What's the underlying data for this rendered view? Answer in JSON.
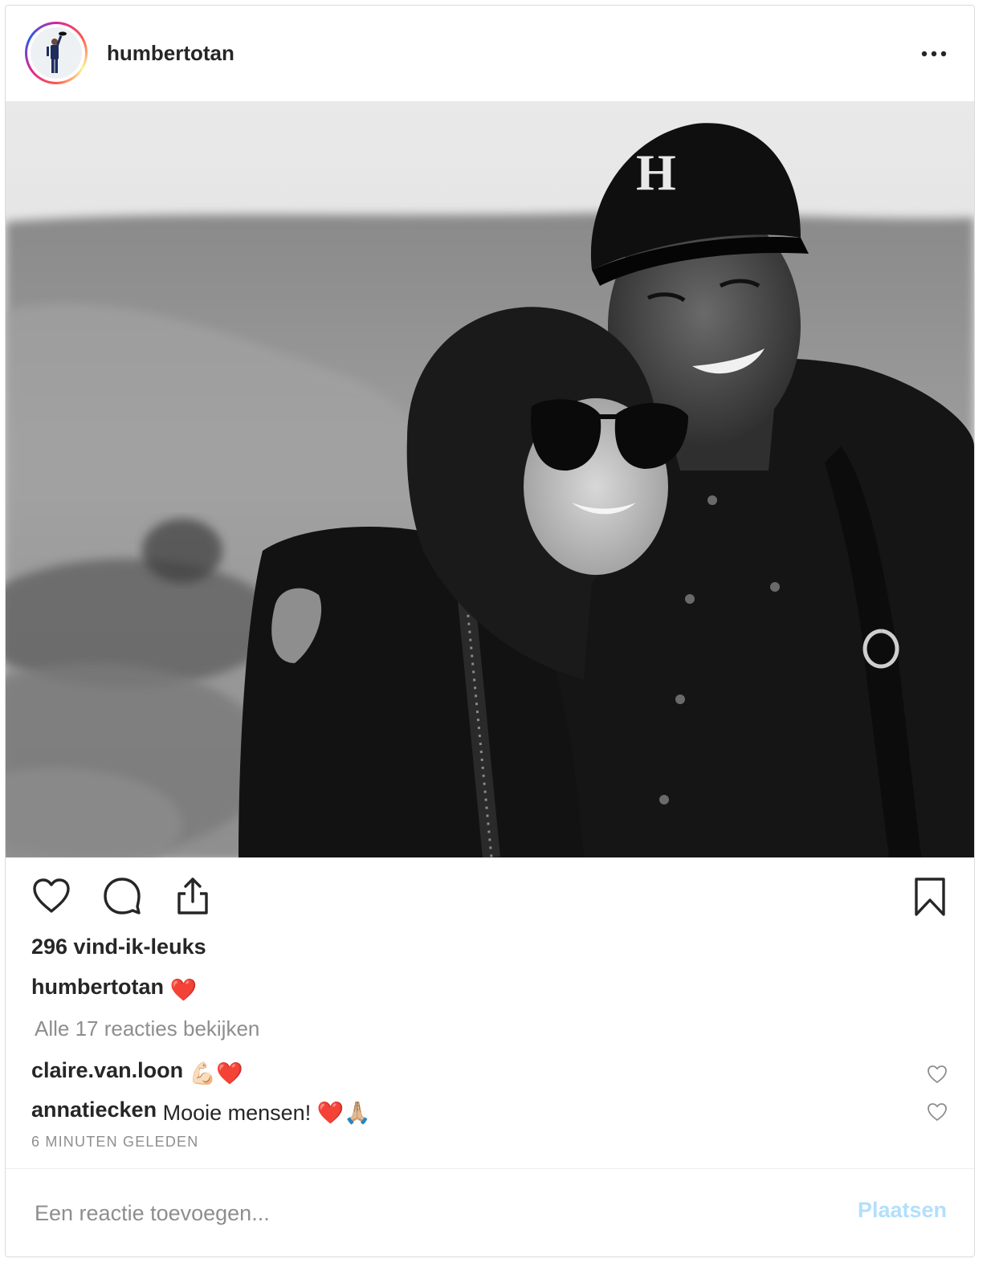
{
  "post": {
    "username": "humbertotan",
    "more_label": "•••",
    "likes_text": "296 vind-ik-leuks",
    "caption": {
      "user": "humbertotan",
      "text": "❤️"
    },
    "view_all_comments": "Alle 17 reacties bekijken",
    "comments": [
      {
        "user": "claire.van.loon",
        "text": "💪🏻❤️"
      },
      {
        "user": "annatiecken",
        "text": "Mooie mensen! ❤️🙏🏼"
      }
    ],
    "timestamp": "6 MINUTEN GELEDEN",
    "comment_input_placeholder": "Een reactie toevoegen...",
    "post_button_label": "Plaatsen",
    "cap_letter": "H"
  },
  "colors": {
    "post_button_disabled": "#b2dffc",
    "heart_red": "#e0245e",
    "muted_text": "#8e8e8e"
  },
  "icons": {
    "like": "heart-icon",
    "comment": "comment-icon",
    "share": "share-icon",
    "save": "bookmark-icon",
    "more": "more-options-icon",
    "comment_like": "small-heart-icon"
  }
}
